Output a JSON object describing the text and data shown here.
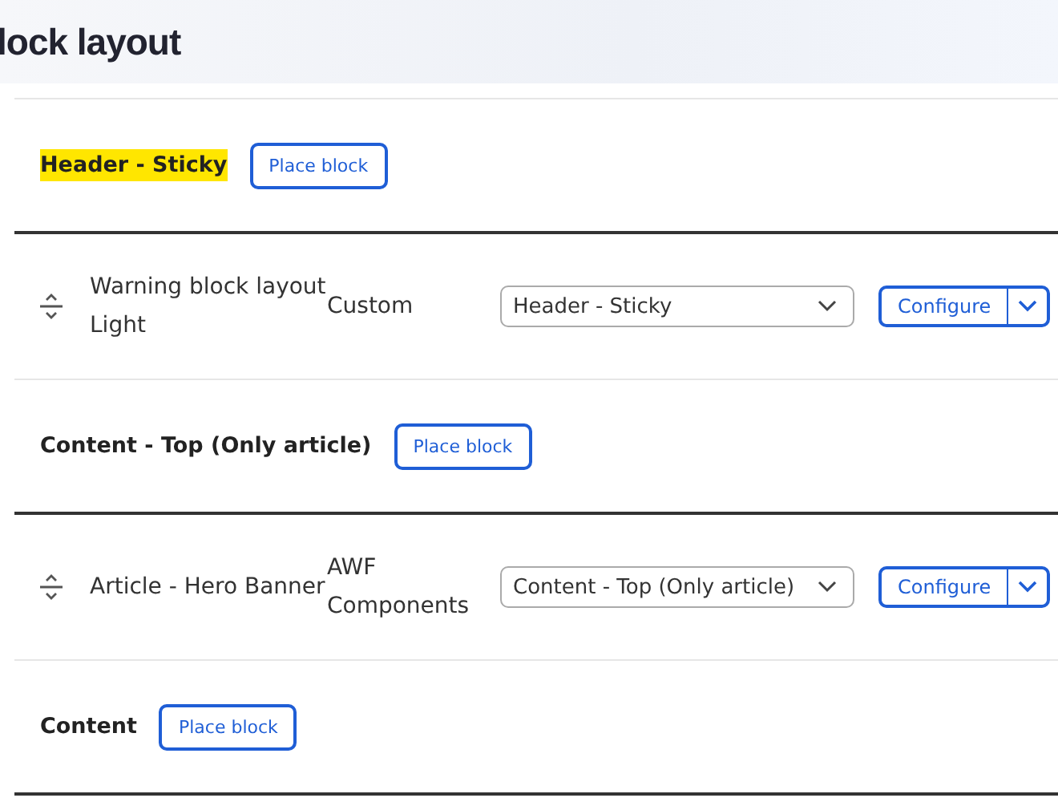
{
  "page_title": "lock layout",
  "regions": [
    {
      "name": "Header - Sticky",
      "highlighted": true,
      "place_button": "Place block",
      "blocks": [
        {
          "name": "Warning block layout Light",
          "category": "Custom",
          "region_select": "Header - Sticky",
          "configure_button": "Configure"
        }
      ]
    },
    {
      "name": "Content - Top (Only article)",
      "highlighted": false,
      "place_button": "Place block",
      "blocks": [
        {
          "name": "Article - Hero Banner",
          "category": "AWF Components",
          "region_select": "Content - Top (Only article)",
          "configure_button": "Configure"
        }
      ]
    },
    {
      "name": "Content",
      "highlighted": false,
      "place_button": "Place block"
    }
  ]
}
